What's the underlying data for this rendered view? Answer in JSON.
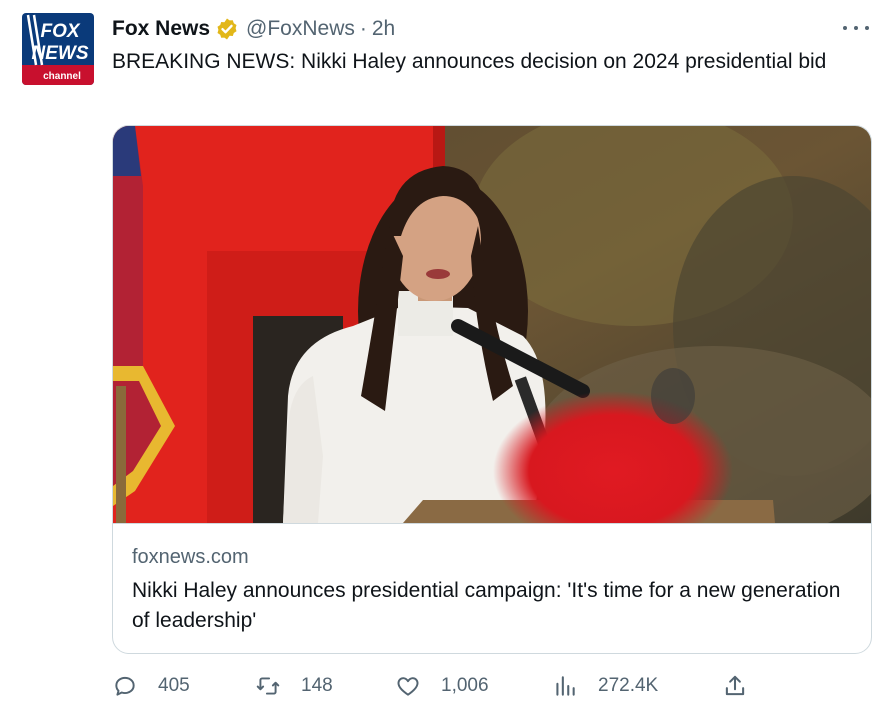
{
  "author": {
    "name": "Fox News",
    "handle": "@FoxNews",
    "separator": "·",
    "time": "2h",
    "avatar_logo": [
      "FOX",
      "NEWS",
      "channel"
    ]
  },
  "tweet": {
    "text": "BREAKING NEWS: Nikki Haley announces decision on 2024 presidential bid"
  },
  "card": {
    "domain": "foxnews.com",
    "title": "Nikki Haley announces presidential campaign: 'It's time for a new generation of leadership'"
  },
  "actions": {
    "replies": "405",
    "retweets": "148",
    "likes": "1,006",
    "views": "272.4K"
  },
  "icons": {
    "verified": "verified-badge-icon",
    "more": "more-icon",
    "reply": "reply-icon",
    "retweet": "retweet-icon",
    "like": "heart-icon",
    "views": "views-icon",
    "share": "share-icon"
  },
  "colors": {
    "text": "#0f1419",
    "secondary": "#536471",
    "border": "#cfd9de",
    "verified_gold": "#e2b719",
    "fox_blue": "#0a3a7a",
    "fox_red": "#c8102e"
  }
}
